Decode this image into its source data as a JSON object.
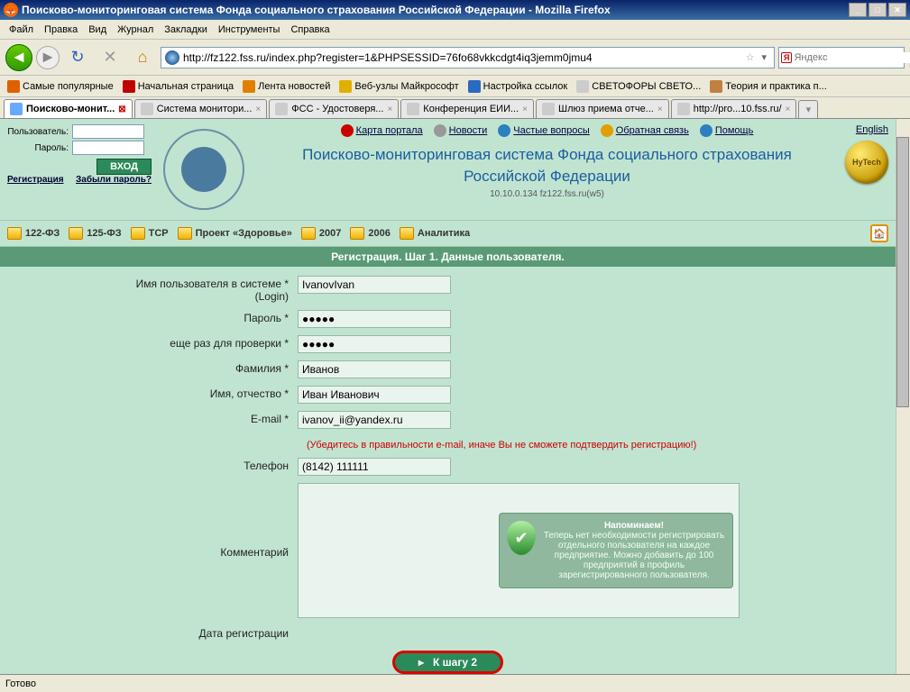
{
  "window": {
    "title": "Поисково-мониторинговая система Фонда социального страхования Российской Федерации - Mozilla Firefox",
    "min": "_",
    "max": "□",
    "close": "✕"
  },
  "menu": {
    "file": "Файл",
    "edit": "Правка",
    "view": "Вид",
    "journal": "Журнал",
    "bookmarks": "Закладки",
    "tools": "Инструменты",
    "help": "Справка"
  },
  "nav": {
    "reload": "↻",
    "stop": "✕",
    "home": "⌂",
    "url": "http://fz122.fss.ru/index.php?register=1&PHPSESSID=76fo68vkkcdgt4iq3jemm0jmu4",
    "star": "☆",
    "search_ya": "Я",
    "search_placeholder": "Яндекс"
  },
  "bookmarks": [
    {
      "label": "Самые популярные",
      "color": "#e06000"
    },
    {
      "label": "Начальная страница",
      "color": "#c00000"
    },
    {
      "label": "Лента новостей",
      "color": "#e08000"
    },
    {
      "label": "Веб-узлы Майкрософт",
      "color": "#e0b000"
    },
    {
      "label": "Настройка ссылок",
      "color": "#2a6ac0"
    },
    {
      "label": "СВЕТОФОРЫ СВЕТО...",
      "color": "#ccc"
    },
    {
      "label": "Теория и практика п...",
      "color": "#c08040"
    }
  ],
  "tabs": [
    {
      "label": "Поисково-монит...",
      "active": true
    },
    {
      "label": "Система монитори..."
    },
    {
      "label": "ФСС - Удостоверя..."
    },
    {
      "label": "Конференция ЕИИ..."
    },
    {
      "label": "Шлюз приема отче..."
    },
    {
      "label": "http://pro...10.fss.ru/"
    }
  ],
  "login": {
    "user_label": "Пользователь:",
    "pass_label": "Пароль:",
    "btn": "ВХОД",
    "reg": "Регистрация",
    "forgot": "Забыли пароль?"
  },
  "portal": {
    "map": "Карта портала",
    "news": "Новости",
    "faq": "Частые вопросы",
    "feedback": "Обратная связь",
    "help": "Помощь",
    "english": "English"
  },
  "site": {
    "title1": "Поисково-мониторинговая система Фонда социального страхования",
    "title2": "Российской Федерации",
    "sub": "10.10.0.134  fz122.fss.ru(w5)"
  },
  "menustrip": [
    "122-ФЗ",
    "125-ФЗ",
    "TCP",
    "Проект «Здоровье»",
    "2007",
    "2006",
    "Аналитика"
  ],
  "stepbar": "Регистрация. Шаг 1. Данные пользователя.",
  "form": {
    "login_label": "Имя пользователя в системе *",
    "login_sublabel": "(Login)",
    "login_val": "IvanovIvan",
    "pass_label": "Пароль *",
    "pass_val": "●●●●●",
    "pass2_label": "еще раз для проверки *",
    "pass2_val": "●●●●●",
    "surname_label": "Фамилия *",
    "surname_val": "Иванов",
    "name_label": "Имя, отчество *",
    "name_val": "Иван Иванович",
    "email_label": "E-mail *",
    "email_val": "ivanov_ii@yandex.ru",
    "email_warn": "(Убедитесь в правильности e-mail, иначе Вы не сможете подтвердить регистрацию!)",
    "phone_label": "Телефон",
    "phone_val": "(8142) 111111",
    "comment_label": "Комментарий",
    "regdate_label": "Дата регистрации",
    "step_btn": "К шагу 2",
    "reminder_title": "Напоминаем!",
    "reminder_text": "Теперь нет необходимости регистрировать отдельного пользователя на каждое предприятие. Можно добавить до 100 предприятий в профиль зарегистрированного пользователя."
  },
  "badge": "HyTech",
  "status": "Готово"
}
